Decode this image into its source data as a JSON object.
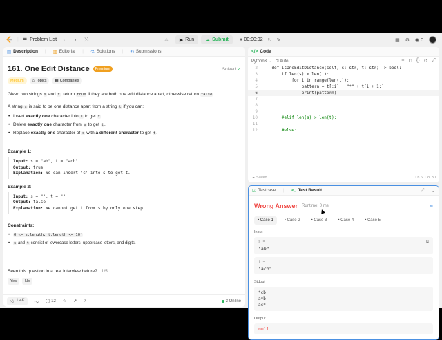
{
  "topbar": {
    "problem_list": "Problem List",
    "run": "Run",
    "submit": "Submit",
    "timer": "00:00:02",
    "coins": "0"
  },
  "tabs": {
    "description": "Description",
    "editorial": "Editorial",
    "solutions": "Solutions",
    "submissions": "Submissions"
  },
  "problem": {
    "title": "161. One Edit Distance",
    "premium": "Premium",
    "solved": "Solved",
    "difficulty": "Medium",
    "topics": "Topics",
    "companies": "Companies",
    "p1a": "Given two strings ",
    "p1s": "s",
    "p1b": " and ",
    "p1t": "t",
    "p1c": ", return ",
    "p1true": "true",
    "p1d": " if they are both one edit distance apart, otherwise return ",
    "p1false": "false",
    "p1e": ".",
    "p2a": "A string ",
    "p2s": "s",
    "p2b": " is said to be one distance apart from a string ",
    "p2t": "t",
    "p2c": " if you can:",
    "b1a": "Insert ",
    "b1b": "exactly one",
    "b1c": " character into ",
    "b1s": "s",
    "b1d": " to get ",
    "b1t": "t",
    "b1e": ".",
    "b2a": "Delete ",
    "b2b": "exactly one",
    "b2c": " character from ",
    "b2s": "s",
    "b2d": " to get ",
    "b2t": "t",
    "b2e": ".",
    "b3a": "Replace ",
    "b3b": "exactly one",
    "b3c": " character of ",
    "b3s": "s",
    "b3d": " with ",
    "b3e": "a different character",
    "b3f": " to get ",
    "b3t": "t",
    "b3g": ".",
    "ex1_title": "Example 1:",
    "ex1_in_k": "Input:",
    "ex1_in_v": " s = \"ab\", t = \"acb\"",
    "ex1_out_k": "Output:",
    "ex1_out_v": " true",
    "ex1_exp_k": "Explanation:",
    "ex1_exp_v": " We can insert 'c' into s to get t.",
    "ex2_title": "Example 2:",
    "ex2_in_k": "Input:",
    "ex2_in_v": " s = \"\", t = \"\"",
    "ex2_out_k": "Output:",
    "ex2_out_v": " false",
    "ex2_exp_k": "Explanation:",
    "ex2_exp_v": " We cannot get t from s by only one step.",
    "constraints_title": "Constraints:",
    "c1": "0 <= s.length, t.length <= 10⁴",
    "c2s": "s",
    "c2a": " and ",
    "c2t": "t",
    "c2b": " consist of lowercase letters, uppercase letters, and digits.",
    "seen": "Seen this question in a real interview before?",
    "seen_count": "1/5",
    "yes": "Yes",
    "no": "No"
  },
  "footer": {
    "likes": "1.4K",
    "comments": "12",
    "online": "3 Online"
  },
  "code": {
    "tab": "Code",
    "lang": "Python3",
    "auto": "Auto",
    "saved": "Saved",
    "position": "Ln 6, Col 30",
    "lines": [
      {
        "n": "2",
        "t": "    def isOneEditDistance(self, s: str, t: str) -> bool:"
      },
      {
        "n": "3",
        "t": "        if len(s) < len(t):"
      },
      {
        "n": "4",
        "t": "            for i in range(len(t)):"
      },
      {
        "n": "5",
        "t": "                pattern = t[:i] + \"*\" + t[i + 1:]"
      },
      {
        "n": "6",
        "t": "                print(pattern)"
      },
      {
        "n": "7",
        "t": ""
      },
      {
        "n": "8",
        "t": ""
      },
      {
        "n": "9",
        "t": ""
      },
      {
        "n": "10",
        "t": "        #elif len(s) > len(t):"
      },
      {
        "n": "11",
        "t": ""
      },
      {
        "n": "12",
        "t": "        #else:"
      }
    ]
  },
  "test": {
    "testcase_tab": "Testcase",
    "result_tab": "Test Result",
    "verdict": "Wrong Answer",
    "runtime": "Runtime: 0 ms",
    "cases": [
      "Case 1",
      "Case 2",
      "Case 3",
      "Case 4",
      "Case 5"
    ],
    "input_label": "Input",
    "s_name": "s =",
    "s_val": "\"ab\"",
    "t_name": "t =",
    "t_val": "\"acb\"",
    "stdout_label": "Stdout",
    "stdout": "*cb\na*b\nac*",
    "output_label": "Output",
    "output": "null"
  }
}
